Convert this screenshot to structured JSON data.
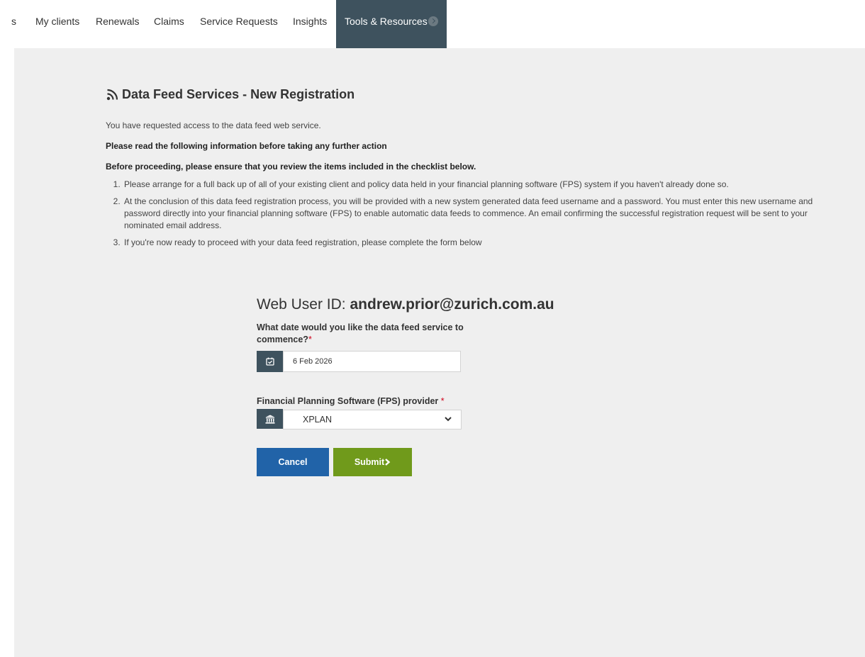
{
  "nav": {
    "items": [
      "s",
      "My clients",
      "Renewals",
      "Claims",
      "Service Requests",
      "Insights"
    ],
    "active": "Tools & Resources"
  },
  "page": {
    "title": "Data Feed Services - New Registration",
    "intro": "You have requested access to the data feed web service.",
    "notice": "Please read the following information before taking any further action",
    "checklist_intro": "Before proceeding, please ensure that you review the items included in the checklist below.",
    "checklist": [
      "Please arrange for a full back up of all of your existing client and policy data held in your financial planning software (FPS) system if you haven't already done so.",
      "At the conclusion of this data feed registration process, you will be provided with a new system generated data feed username and a password. You must enter this new username and password directly into your financial planning software (FPS) to enable automatic data feeds to commence. An email confirming the successful registration request will be sent to your nominated email address.",
      "If you're now ready to proceed with your data feed registration, please complete the form below"
    ]
  },
  "form": {
    "web_user_label": "Web User ID:",
    "web_user_id": "andrew.prior@zurich.com.au",
    "date_label": "What date would you like the data feed service to commence?",
    "required_mark": "*",
    "date_value": "6 Feb 2026",
    "fps_label": "Financial Planning Software (FPS) provider",
    "fps_value": "XPLAN",
    "cancel_label": "Cancel",
    "submit_label": "Submit"
  },
  "colors": {
    "nav_active_bg": "#3e525e",
    "panel_bg": "#efefef",
    "cancel_bg": "#2163a8",
    "submit_bg": "#709a1b",
    "required": "#d0021b"
  },
  "icons": {
    "title": "rss-icon",
    "date": "calendar-check-icon",
    "fps": "institution-icon",
    "select": "chevron-down-icon",
    "submit": "chevron-right-icon",
    "nav_active": "circle-chevron-right-icon"
  }
}
